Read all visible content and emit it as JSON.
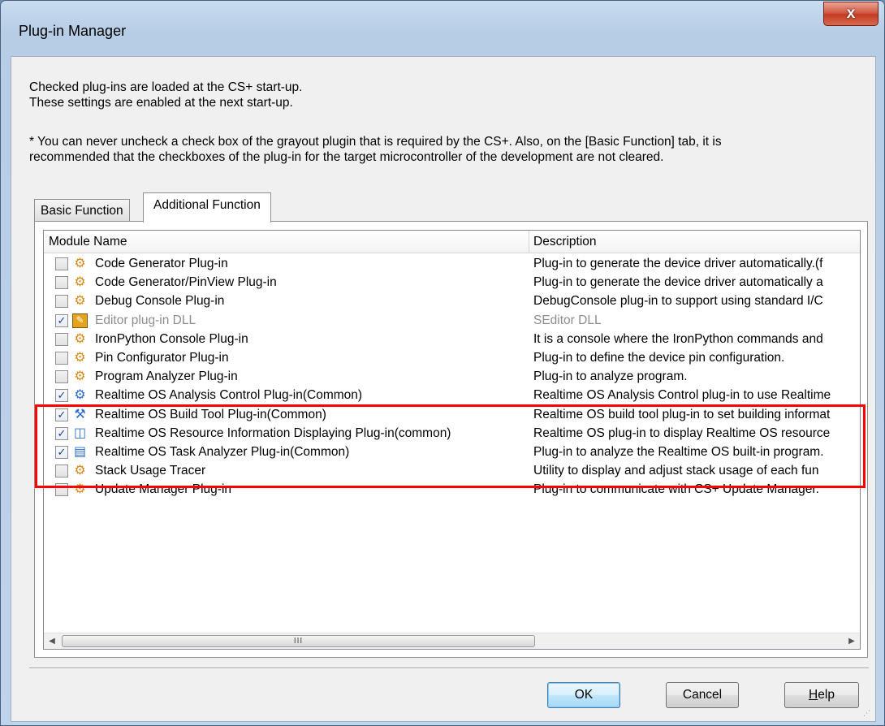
{
  "window": {
    "title": "Plug-in Manager",
    "close_glyph": "x"
  },
  "info": {
    "line1": "Checked plug-ins are loaded at the CS+ start-up.",
    "line2": "These settings are enabled at the next start-up.",
    "note1": "* You can never uncheck a check box of the grayout plugin that is required by the CS+. Also, on the [Basic Function] tab, it is",
    "note2": "recommended that the checkboxes of the plug-in for the target microcontroller of the development are not cleared."
  },
  "tabs": [
    "Basic Function",
    "Additional Function"
  ],
  "active_tab": "Additional Function",
  "list": {
    "columns": [
      "Module Name",
      "Description"
    ],
    "rows": [
      {
        "checked": false,
        "grayed": false,
        "icon": "gear-plugin-icon",
        "name": "Code Generator Plug-in",
        "description": "Plug-in to generate the device driver automatically.(f"
      },
      {
        "checked": false,
        "grayed": false,
        "icon": "gear-plugin-icon",
        "name": "Code Generator/PinView Plug-in",
        "description": "Plug-in to generate the device driver automatically a"
      },
      {
        "checked": false,
        "grayed": false,
        "icon": "gear-plugin-icon",
        "name": "Debug Console Plug-in",
        "description": "DebugConsole plug-in to support using standard I/C"
      },
      {
        "checked": true,
        "grayed": true,
        "icon": "document-plugin-icon",
        "name": "Editor plug-in DLL",
        "description": "SEditor DLL"
      },
      {
        "checked": false,
        "grayed": false,
        "icon": "gear-plugin-icon",
        "name": "IronPython Console Plug-in",
        "description": "It is a console where the IronPython commands and"
      },
      {
        "checked": false,
        "grayed": false,
        "icon": "gear-plugin-icon",
        "name": "Pin Configurator Plug-in",
        "description": "Plug-in to define the device pin configuration."
      },
      {
        "checked": false,
        "grayed": false,
        "icon": "gear-plugin-icon",
        "name": "Program Analyzer Plug-in",
        "description": "Plug-in to analyze program."
      },
      {
        "checked": true,
        "grayed": false,
        "icon": "rtos-analysis-icon",
        "name": "Realtime OS Analysis Control Plug-in(Common)",
        "description": "Realtime OS Analysis Control plug-in to use Realtime"
      },
      {
        "checked": true,
        "grayed": false,
        "icon": "rtos-build-icon",
        "name": "Realtime OS Build Tool Plug-in(Common)",
        "description": "Realtime OS build tool plug-in to set building informat"
      },
      {
        "checked": true,
        "grayed": false,
        "icon": "rtos-resource-icon",
        "name": "Realtime OS Resource Information Displaying Plug-in(common)",
        "description": "Realtime OS plug-in to display Realtime OS resource"
      },
      {
        "checked": true,
        "grayed": false,
        "icon": "rtos-task-icon",
        "name": "Realtime OS Task Analyzer Plug-in(Common)",
        "description": "Plug-in to analyze the Realtime OS built-in program."
      },
      {
        "checked": false,
        "grayed": false,
        "icon": "gear-plugin-icon",
        "name": "Stack Usage Tracer",
        "description": "Utility to display and adjust stack usage of each fun"
      },
      {
        "checked": false,
        "grayed": false,
        "icon": "gear-plugin-icon",
        "name": "Update Manager Plug-in",
        "description": "Plug-in to communicate with CS+ Update Manager."
      }
    ],
    "scrollbar": {
      "thumb_grip": "III"
    }
  },
  "buttons": {
    "ok": "OK",
    "cancel": "Cancel",
    "help": "Help"
  },
  "colors": {
    "highlight_box": "#ff0000",
    "checkmark": "#1c3f94"
  }
}
